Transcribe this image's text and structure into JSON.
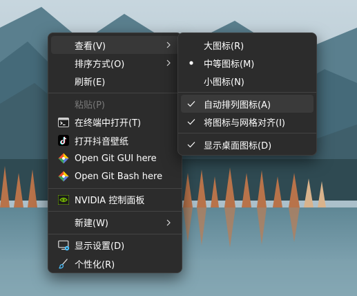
{
  "main_menu": {
    "view": "查看(V)",
    "sort": "排序方式(O)",
    "refresh": "刷新(E)",
    "paste": "粘贴(P)",
    "terminal": "在终端中打开(T)",
    "douyin": "打开抖音壁纸",
    "git_gui": "Open Git GUI here",
    "git_bash": "Open Git Bash here",
    "nvidia": "NVIDIA 控制面板",
    "new": "新建(W)",
    "display": "显示设置(D)",
    "personalize": "个性化(R)"
  },
  "view_submenu": {
    "large_icons": "大图标(R)",
    "medium_icons": "中等图标(M)",
    "small_icons": "小图标(N)",
    "auto_arrange": "自动排列图标(A)",
    "align_grid": "将图标与网格对齐(I)",
    "show_desktop_icons": "显示桌面图标(D)"
  },
  "icons": {
    "terminal": "terminal-icon",
    "douyin": "tiktok-icon",
    "git_gui": "git-icon",
    "git_bash": "git-icon",
    "nvidia": "nvidia-icon",
    "display": "display-settings-icon",
    "personalize": "brush-icon",
    "submenu_arrow": "chevron-right-icon",
    "radio": "bullet-icon",
    "check": "check-icon"
  },
  "colors": {
    "menu_bg": "#2c2c2c",
    "text": "#ffffff",
    "disabled_text": "#7a7a7a",
    "nvidia_green": "#76b900",
    "accent_blue": "#4cc2ff"
  }
}
